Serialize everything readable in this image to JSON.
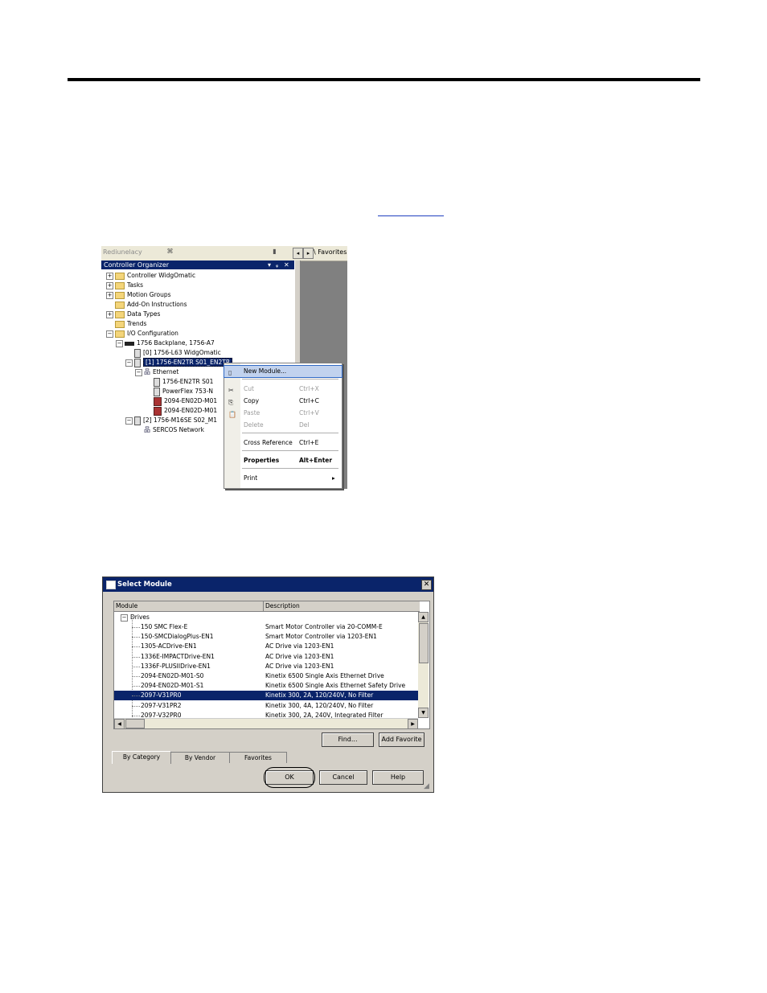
{
  "screenshot1": {
    "toolbar": {
      "readonly_label": "Rediunelacy",
      "favorites_tab": "Favorites"
    },
    "organizer": {
      "title": "Controller Organizer",
      "title_buttons": [
        "▾",
        "ᵩ",
        "✕"
      ],
      "tree": [
        {
          "label": "Controller WidgOmatic",
          "toggle": "+",
          "kind": "folder"
        },
        {
          "label": "Tasks",
          "toggle": "+",
          "kind": "folder"
        },
        {
          "label": "Motion Groups",
          "toggle": "+",
          "kind": "folder"
        },
        {
          "label": "Add-On Instructions",
          "toggle": "",
          "kind": "folder"
        },
        {
          "label": "Data Types",
          "toggle": "+",
          "kind": "folder"
        },
        {
          "label": "Trends",
          "toggle": "",
          "kind": "folder"
        },
        {
          "label": "I/O Configuration",
          "toggle": "−",
          "kind": "folder"
        },
        {
          "label": "1756 Backplane, 1756-A7",
          "toggle": "−",
          "kind": "backplane"
        },
        {
          "label": "[0] 1756-L63 WidgOmatic",
          "toggle": "",
          "kind": "module"
        },
        {
          "label": "[1] 1756-EN2TR S01_EN2TR",
          "toggle": "−",
          "kind": "module",
          "selected": true
        },
        {
          "label": "Ethernet",
          "toggle": "−",
          "kind": "network"
        },
        {
          "label": "1756-EN2TR S01",
          "toggle": "",
          "kind": "module"
        },
        {
          "label": "PowerFlex 753-N",
          "toggle": "",
          "kind": "module"
        },
        {
          "label": "2094-EN02D-M01",
          "toggle": "",
          "kind": "drive"
        },
        {
          "label": "2094-EN02D-M01",
          "toggle": "",
          "kind": "drive"
        },
        {
          "label": "[2] 1756-M16SE S02_M1",
          "toggle": "−",
          "kind": "module"
        },
        {
          "label": "SERCOS Network",
          "toggle": "",
          "kind": "network"
        }
      ]
    },
    "context_menu": {
      "items": [
        {
          "label": "New Module...",
          "shortcut": "",
          "state": "highlight"
        },
        {
          "label": "Cut",
          "shortcut": "Ctrl+X",
          "state": "disabled"
        },
        {
          "label": "Copy",
          "shortcut": "Ctrl+C",
          "state": "enabled"
        },
        {
          "label": "Paste",
          "shortcut": "Ctrl+V",
          "state": "disabled"
        },
        {
          "label": "Delete",
          "shortcut": "Del",
          "state": "disabled"
        },
        {
          "label": "Cross Reference",
          "shortcut": "Ctrl+E",
          "state": "enabled"
        },
        {
          "label": "Properties",
          "shortcut": "Alt+Enter",
          "state": "bold"
        },
        {
          "label": "Print",
          "shortcut": "▸",
          "state": "enabled"
        }
      ]
    }
  },
  "screenshot2": {
    "title": "Select Module",
    "columns": {
      "module": "Module",
      "description": "Description"
    },
    "group": "Drives",
    "rows": [
      {
        "module": "150 SMC Flex-E",
        "description": "Smart Motor Controller via 20-COMM-E"
      },
      {
        "module": "150-SMCDialogPlus-EN1",
        "description": "Smart Motor Controller via 1203-EN1"
      },
      {
        "module": "1305-ACDrive-EN1",
        "description": "AC Drive via 1203-EN1"
      },
      {
        "module": "1336E-IMPACTDrive-EN1",
        "description": "AC Drive via 1203-EN1"
      },
      {
        "module": "1336F-PLUSIIDrive-EN1",
        "description": "AC Drive via 1203-EN1"
      },
      {
        "module": "2094-EN02D-M01-S0",
        "description": "Kinetix 6500 Single Axis Ethernet Drive"
      },
      {
        "module": "2094-EN02D-M01-S1",
        "description": "Kinetix 6500 Single Axis Ethernet Safety Drive"
      },
      {
        "module": "2097-V31PR0",
        "description": "Kinetix 300, 2A, 120/240V, No Filter",
        "selected": true
      },
      {
        "module": "2097-V31PR2",
        "description": "Kinetix 300, 4A, 120/240V, No Filter"
      },
      {
        "module": "2097-V32PR0",
        "description": "Kinetix 300, 2A, 240V, Integrated Filter"
      }
    ],
    "buttons": {
      "find": "Find...",
      "add_favorite": "Add Favorite",
      "ok": "OK",
      "cancel": "Cancel",
      "help": "Help"
    },
    "tabs": [
      "By Category",
      "By Vendor",
      "Favorites"
    ]
  }
}
